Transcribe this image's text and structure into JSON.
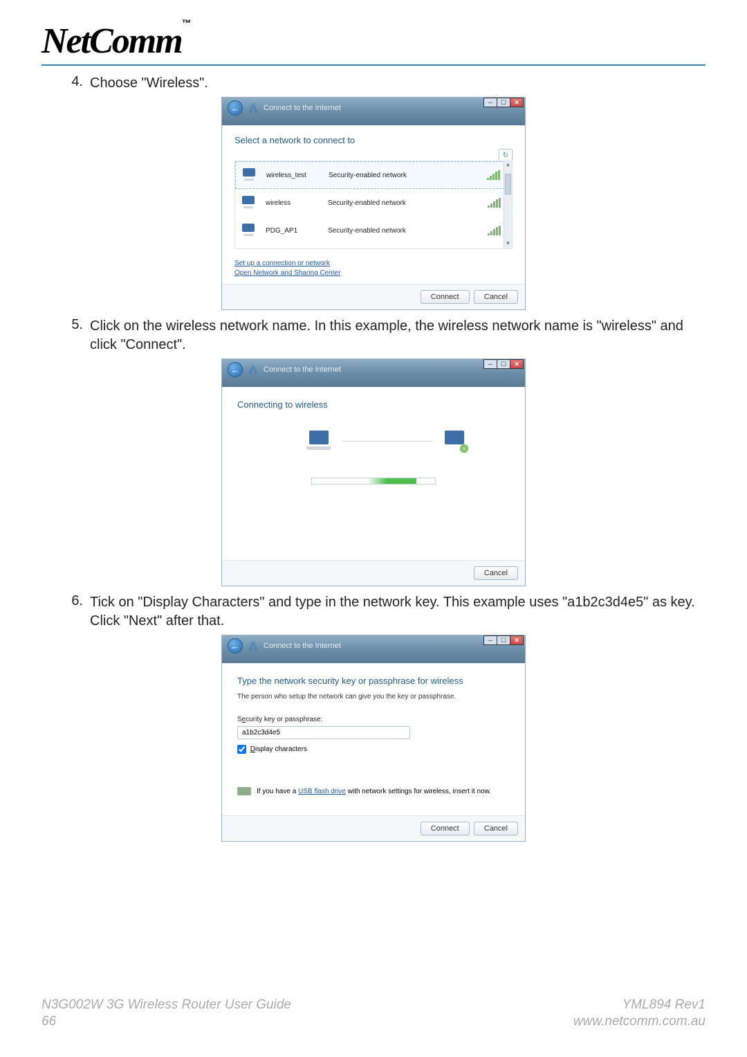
{
  "logo_text": "NetComm",
  "logo_tm": "™",
  "steps": {
    "s4": {
      "num": "4.",
      "text": "Choose \"Wireless\"."
    },
    "s5": {
      "num": "5.",
      "text": "Click on the wireless network name. In this example, the wireless network name is \"wireless\" and click \"Connect\"."
    },
    "s6": {
      "num": "6.",
      "text": "Tick on \"Display Characters\" and type in the network key. This example uses \"a1b2c3d4e5\" as key. Click \"Next\" after that."
    }
  },
  "dialog1": {
    "breadcrumb": "Connect to the Internet",
    "title": "Select a network to connect to",
    "refresh": "↻",
    "networks": {
      "n0": {
        "name": "wireless_test",
        "desc": "Security-enabled network"
      },
      "n1": {
        "name": "wireless",
        "desc": "Security-enabled network"
      },
      "n2": {
        "name": "PDG_AP1",
        "desc": "Security-enabled network"
      }
    },
    "link1": "Set up a connection or network",
    "link2": "Open Network and Sharing Center",
    "connect": "Connect",
    "cancel": "Cancel"
  },
  "dialog2": {
    "breadcrumb": "Connect to the Internet",
    "title": "Connecting to wireless",
    "cancel": "Cancel"
  },
  "dialog3": {
    "breadcrumb": "Connect to the Internet",
    "title": "Type the network security key or passphrase for wireless",
    "sub": "The person who setup the network can give you the key or passphrase.",
    "key_label_pre": "S",
    "key_label_u": "e",
    "key_label_post": "curity key or passphrase:",
    "key_value": "a1b2c3d4e5",
    "disp_u": "D",
    "disp_post": "isplay characters",
    "usb_pre": "If you have a ",
    "usb_link": "USB flash drive",
    "usb_post": " with network settings for wireless, insert it now.",
    "connect": "Connect",
    "cancel": "Cancel"
  },
  "footer": {
    "doc_title": "N3G002W 3G Wireless Router User Guide",
    "rev": "YML894 Rev1",
    "page": "66",
    "url": "www.netcomm.com.au"
  }
}
